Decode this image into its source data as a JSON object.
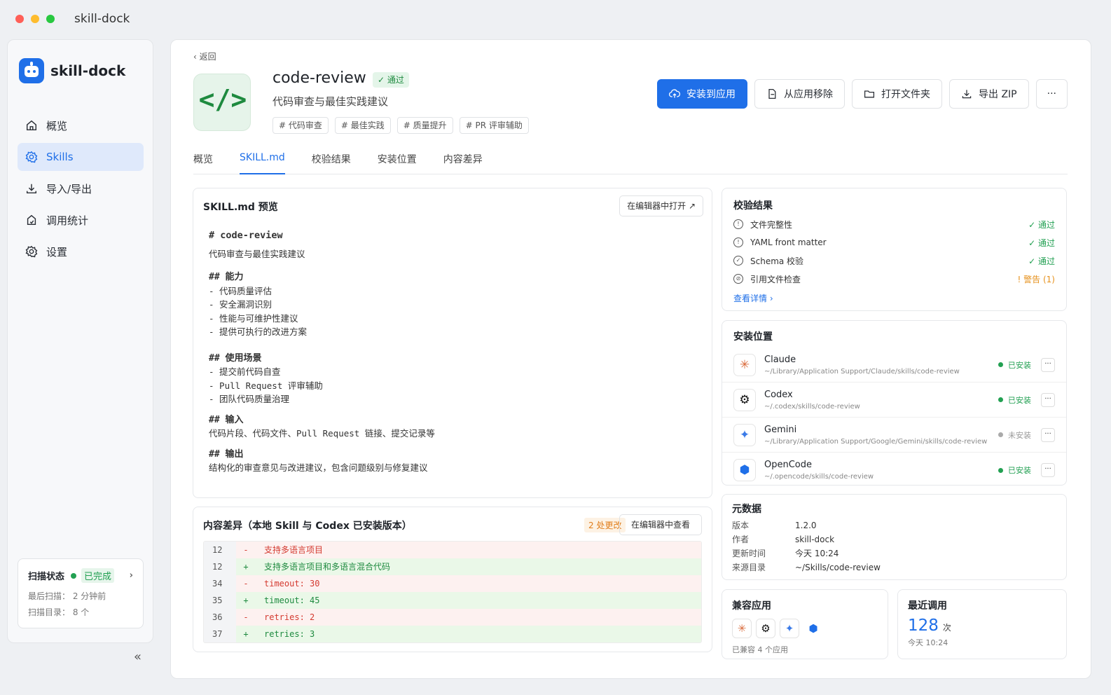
{
  "window": {
    "title": "skill-dock"
  },
  "sidebar": {
    "brand": "skill-dock",
    "items": [
      {
        "label": "概览",
        "icon": "home-icon"
      },
      {
        "label": "Skills",
        "icon": "gear-icon"
      },
      {
        "label": "导入/导出",
        "icon": "download-icon"
      },
      {
        "label": "调用统计",
        "icon": "stats-icon"
      },
      {
        "label": "设置",
        "icon": "settings-icon"
      }
    ],
    "scan": {
      "label": "扫描状态",
      "status": "已完成",
      "last": "最后扫描： 2 分钟前",
      "dirs": "扫描目录： 8 个"
    }
  },
  "header": {
    "back": "返回",
    "title": "code-review",
    "badge": "通过",
    "subtitle": "代码审查与最佳实践建议",
    "icon_glyph": "</>",
    "tags": [
      "# 代码审查",
      "# 最佳实践",
      "# 质量提升",
      "# PR 评审辅助"
    ],
    "actions": {
      "install": "安装到应用",
      "remove": "从应用移除",
      "open_folder": "打开文件夹",
      "export": "导出 ZIP",
      "more": "···"
    }
  },
  "tabs": [
    "概览",
    "SKILL.md",
    "校验结果",
    "安装位置",
    "内容差异"
  ],
  "preview": {
    "title": "SKILL.md 预览",
    "open_editor": "在编辑器中打开",
    "h1": "# code-review",
    "desc": "代码审查与最佳实践建议",
    "cap_h": "## 能力",
    "cap": [
      "- 代码质量评估",
      "- 安全漏洞识别",
      "- 性能与可维护性建议",
      "- 提供可执行的改进方案"
    ],
    "use_h": "## 使用场景",
    "use": [
      "- 提交前代码自查",
      "- Pull Request 评审辅助",
      "- 团队代码质量治理"
    ],
    "in_h": "## 输入",
    "in": "代码片段、代码文件、Pull Request 链接、提交记录等",
    "out_h": "## 输出",
    "out": "结构化的审查意见与改进建议，包含问题级别与修复建议"
  },
  "diff": {
    "title": "内容差异（本地 Skill 与 Codex 已安装版本）",
    "count": "2 处更改",
    "view": "在编辑器中查看",
    "rows": [
      {
        "num": "12",
        "sign": "-",
        "text": "支持多语言项目",
        "type": "del"
      },
      {
        "num": "12",
        "sign": "+",
        "text": "支持多语言项目和多语言混合代码",
        "type": "add"
      },
      {
        "num": "34",
        "sign": "-",
        "text": "timeout: 30",
        "type": "del"
      },
      {
        "num": "35",
        "sign": "+",
        "text": "timeout: 45",
        "type": "add"
      },
      {
        "num": "36",
        "sign": "-",
        "text": "retries: 2",
        "type": "del"
      },
      {
        "num": "37",
        "sign": "+",
        "text": "retries: 3",
        "type": "add"
      }
    ]
  },
  "validation": {
    "title": "校验结果",
    "rows": [
      {
        "label": "文件完整性",
        "status": "通过"
      },
      {
        "label": "YAML front matter",
        "status": "通过"
      },
      {
        "label": "Schema 校验",
        "status": "通过"
      },
      {
        "label": "引用文件检查",
        "status": "警告 (1)"
      }
    ],
    "detail": "查看详情 ›"
  },
  "locations": {
    "title": "安装位置",
    "rows": [
      {
        "name": "Claude",
        "path": "~/Library/Application Support/Claude/skills/code-review",
        "status": "已安装",
        "glyph": "✳",
        "color": "#d96a3b"
      },
      {
        "name": "Codex",
        "path": "~/.codex/skills/code-review",
        "status": "已安装",
        "glyph": "⚙",
        "color": "#111111"
      },
      {
        "name": "Gemini",
        "path": "~/Library/Application Support/Google/Gemini/skills/code-review",
        "status": "未安装",
        "glyph": "✦",
        "color": "#3b7be8"
      },
      {
        "name": "OpenCode",
        "path": "~/.opencode/skills/code-review",
        "status": "已安装",
        "glyph": "⬢",
        "color": "#1f6fe8"
      }
    ]
  },
  "metadata": {
    "title": "元数据",
    "rows": [
      {
        "k": "版本",
        "v": "1.2.0"
      },
      {
        "k": "作者",
        "v": "skill-dock"
      },
      {
        "k": "更新时间",
        "v": "今天 10:24"
      },
      {
        "k": "来源目录",
        "v": "~/Skills/code-review"
      }
    ]
  },
  "compat": {
    "title": "兼容应用",
    "sub": "已兼容 4 个应用"
  },
  "usage": {
    "title": "最近调用",
    "count": "128",
    "unit": "次",
    "time": "今天 10:24"
  },
  "colors": {
    "accent": "#1f6fe8",
    "success": "#22a052",
    "warning": "#e6911c",
    "danger": "#d43a30"
  }
}
